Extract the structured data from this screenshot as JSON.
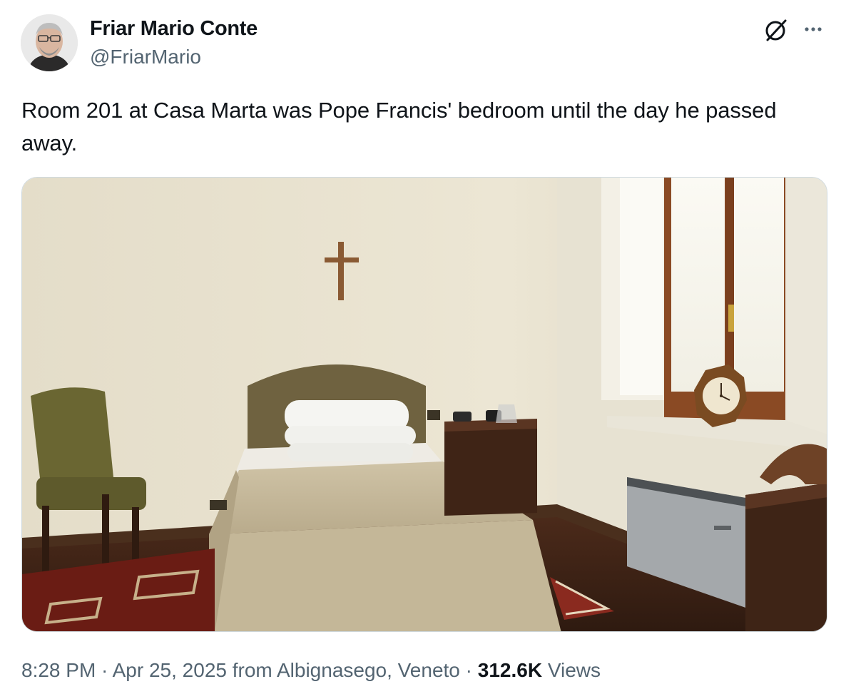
{
  "author": {
    "name": "Friar Mario Conte",
    "handle": "@FriarMario"
  },
  "tweet": {
    "text": "Room 201 at Casa Marta was Pope Francis' bedroom until the day he passed away."
  },
  "icons": {
    "grok": "grok-icon",
    "more": "more-icon"
  },
  "meta": {
    "time": "8:28 PM",
    "separator": " · ",
    "date": "Apr 25, 2025",
    "location": " from Albignasego, Veneto",
    "views_count": "312.6K",
    "views_label": " Views"
  },
  "colors": {
    "text_primary": "#0f1419",
    "text_secondary": "#536471",
    "border": "#cfd9de"
  }
}
